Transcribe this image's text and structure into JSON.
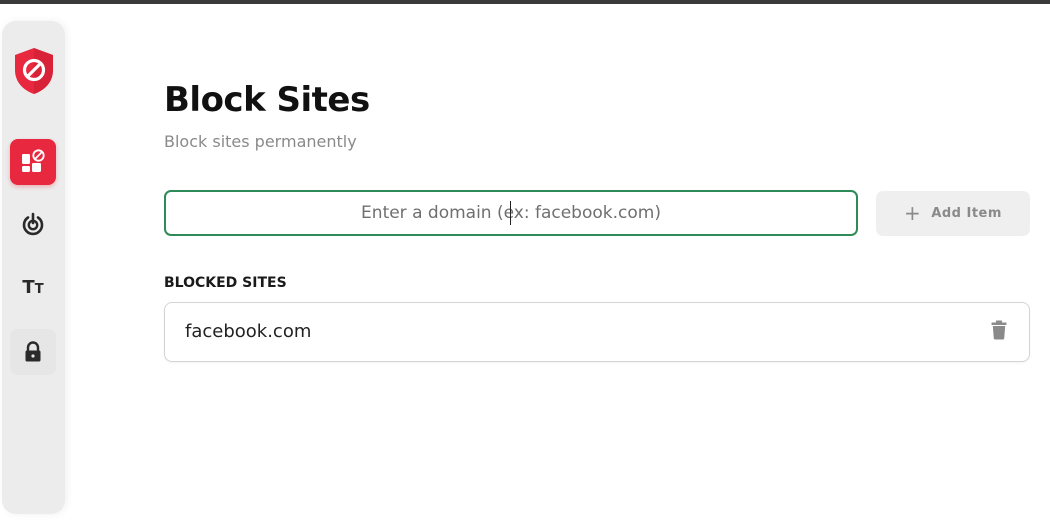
{
  "page": {
    "title": "Block Sites",
    "subtitle": "Block sites permanently"
  },
  "input": {
    "placeholder": "Enter a domain (ex: facebook.com)",
    "value": ""
  },
  "add_button": {
    "icon": "plus-icon",
    "label": "Add Item"
  },
  "blocked": {
    "heading": "BLOCKED SITES",
    "sites": [
      {
        "domain": "facebook.com",
        "delete_icon": "trash-icon"
      }
    ]
  },
  "sidebar": {
    "logo_icon": "shield-block-icon",
    "items": [
      {
        "icon": "block-sites-icon",
        "active": true
      },
      {
        "icon": "focus-icon",
        "active": false
      },
      {
        "icon": "text-size-icon",
        "active": false
      },
      {
        "icon": "lock-icon",
        "active": false
      }
    ]
  },
  "colors": {
    "accent_red": "#e8283f",
    "input_border_green": "#2e8b57",
    "sidebar_bg": "#ececec"
  }
}
